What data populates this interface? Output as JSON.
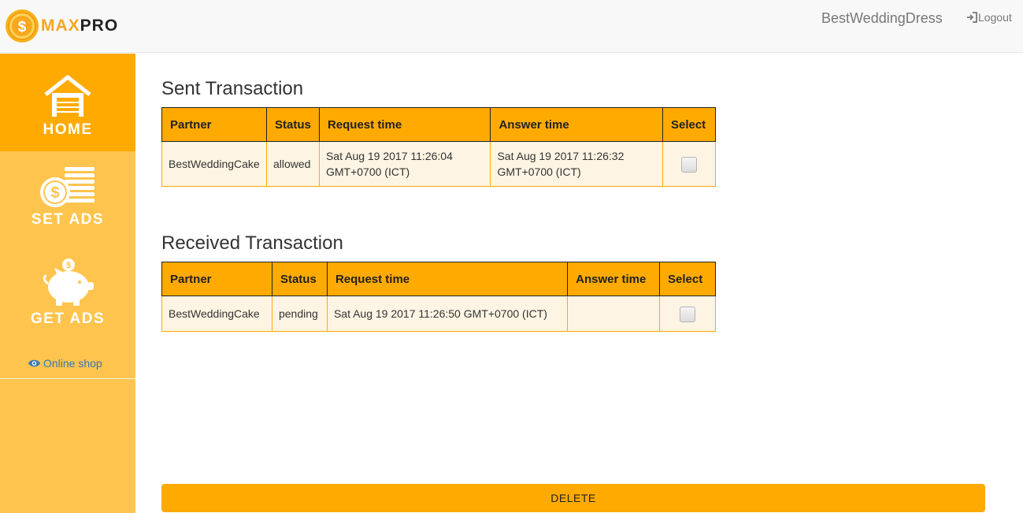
{
  "header": {
    "logo_max": "MAX",
    "logo_pro": "PRO",
    "user_name": "BestWeddingDress",
    "logout_label": "Logout"
  },
  "sidebar": {
    "items": [
      {
        "label": "HOME",
        "icon": "garage-home-icon",
        "active": true
      },
      {
        "label": "SET ADS",
        "icon": "coins-stack-icon",
        "active": false
      },
      {
        "label": "GET ADS",
        "icon": "piggy-bank-icon",
        "active": false
      }
    ],
    "online_shop_label": "Online shop",
    "online_shop_icon": "eye-icon"
  },
  "sent": {
    "title": "Sent Transaction",
    "columns": [
      "Partner",
      "Status",
      "Request time",
      "Answer time",
      "Select"
    ],
    "rows": [
      {
        "partner": "BestWeddingCake",
        "status": "allowed",
        "request_time": "Sat Aug 19 2017 11:26:04 GMT+0700 (ICT)",
        "answer_time": "Sat Aug 19 2017 11:26:32 GMT+0700 (ICT)",
        "selected": false
      }
    ]
  },
  "received": {
    "title": "Received Transaction",
    "columns": [
      "Partner",
      "Status",
      "Request time",
      "Answer time",
      "Select"
    ],
    "rows": [
      {
        "partner": "BestWeddingCake",
        "status": "pending",
        "request_time": "Sat Aug 19 2017 11:26:50 GMT+0700 (ICT)",
        "answer_time": "",
        "selected": false
      }
    ]
  },
  "actions": {
    "delete_label": "DELETE"
  },
  "colors": {
    "accent": "#ffaa00",
    "sidebar_bg": "#ffc44d",
    "row_bg": "#fef4e3",
    "link": "#337ab7"
  }
}
